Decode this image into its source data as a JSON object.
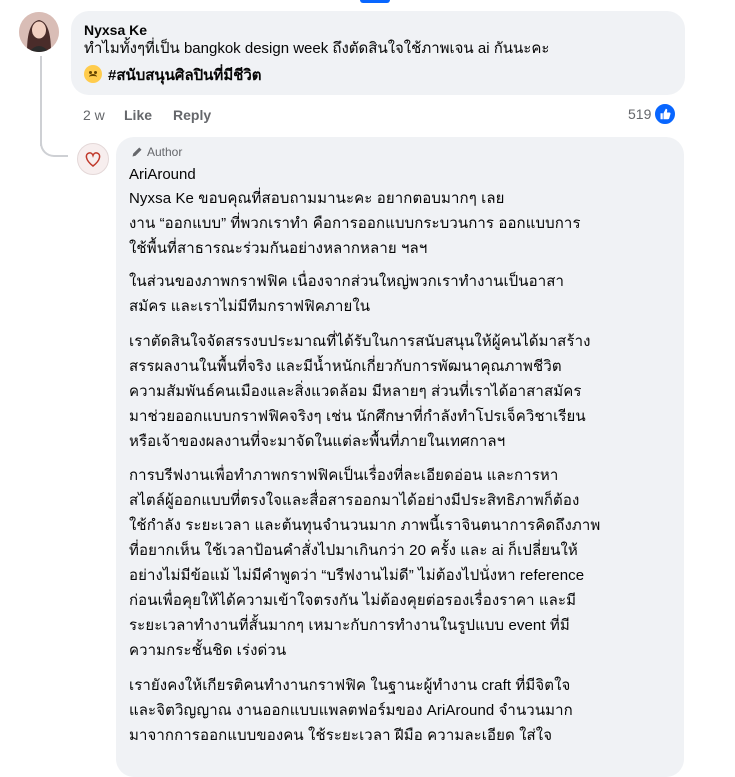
{
  "comment": {
    "author": "Nyxsa Ke",
    "lines": [
      "ทำไมทั้งๆที่เป็น bangkok design week ถึงตัดสินใจใช้ภาพเจน ai กันนะคะ",
      "#สนับสนุนศิลปินที่มีชีวิต"
    ],
    "time": "2 w",
    "like_label": "Like",
    "reply_label": "Reply",
    "reaction_count": "519"
  },
  "reply": {
    "badge": "Author",
    "author": "AriAround",
    "paragraphs": [
      [
        "Nyxsa Ke ขอบคุณที่สอบถามมานะคะ อยากตอบมากๆ เลย",
        "งาน “ออกแบบ” ที่พวกเราทำ คือการออกแบบกระบวนการ ออกแบบการ",
        "ใช้พื้นที่สาธารณะร่วมกันอย่างหลากหลาย ฯลฯ"
      ],
      [
        "ในส่วนของภาพกราฟฟิค เนื่องจากส่วนใหญ่พวกเราทำงานเป็นอาสา",
        "สมัคร และเราไม่มีทีมกราฟฟิคภายใน"
      ],
      [
        "เราตัดสินใจจัดสรรงบประมาณที่ได้รับในการสนับสนุนให้ผู้คนได้มาสร้าง",
        "สรรผลงานในพื้นที่จริง และมีน้ำหนักเกี่ยวกับการพัฒนาคุณภาพชีวิต",
        "ความสัมพันธ์คนเมืองและสิ่งแวดล้อม มีหลายๆ ส่วนที่เราได้อาสาสมัคร",
        "มาช่วยออกแบบกราฟฟิคจริงๆ เช่น นักศึกษาที่กำลังทำโปรเจ็ควิชาเรียน",
        "หรือเจ้าของผลงานที่จะมาจัดในแต่ละพื้นที่ภายในเทศกาลฯ"
      ],
      [
        "การบรีฟงานเพื่อทำภาพกราฟฟิคเป็นเรื่องที่ละเอียดอ่อน และการหา",
        "สไตล์ผู้ออกแบบที่ตรงใจและสื่อสารออกมาได้อย่างมีประสิทธิภาพก็ต้อง",
        "ใช้กำลัง ระยะเวลา และต้นทุนจำนวนมาก ภาพนี้เราจินตนาการคิดถึงภาพ",
        "ที่อยากเห็น ใช้เวลาป้อนคำสั่งไปมาเกินกว่า 20 ครั้ง และ ai ก็เปลี่ยนให้",
        "อย่างไม่มีข้อแม้ ไม่มีคำพูดว่า “บรีฟงานไม่ดี” ไม่ต้องไปนั่งหา reference",
        "ก่อนเพื่อคุยให้ได้ความเข้าใจตรงกัน ไม่ต้องคุยต่อรองเรื่องราคา และมี",
        "ระยะเวลาทำงานที่สั้นมากๆ เหมาะกับการทำงานในรูปแบบ event ที่มี",
        "ความกระชั้นชิด เร่งด่วน"
      ],
      [
        "เรายังคงให้เกียรติคนทำงานกราฟฟิค ในฐานะผู้ทำงาน craft ที่มีจิตใจ",
        "และจิตวิญญาณ งานออกแบบแพลตฟอร์มของ AriAround จำนวนมาก",
        "มาจากการออกแบบของคน ใช้ระยะเวลา ฝีมือ ความละเอียด ใส่ใจ"
      ]
    ]
  },
  "colors": {
    "accent": "#0866ff",
    "bubble": "#f0f2f5",
    "meta": "#65676b"
  },
  "icons": [
    "like-thumb-icon",
    "pencil-icon",
    "sad-face-emoji-icon"
  ]
}
